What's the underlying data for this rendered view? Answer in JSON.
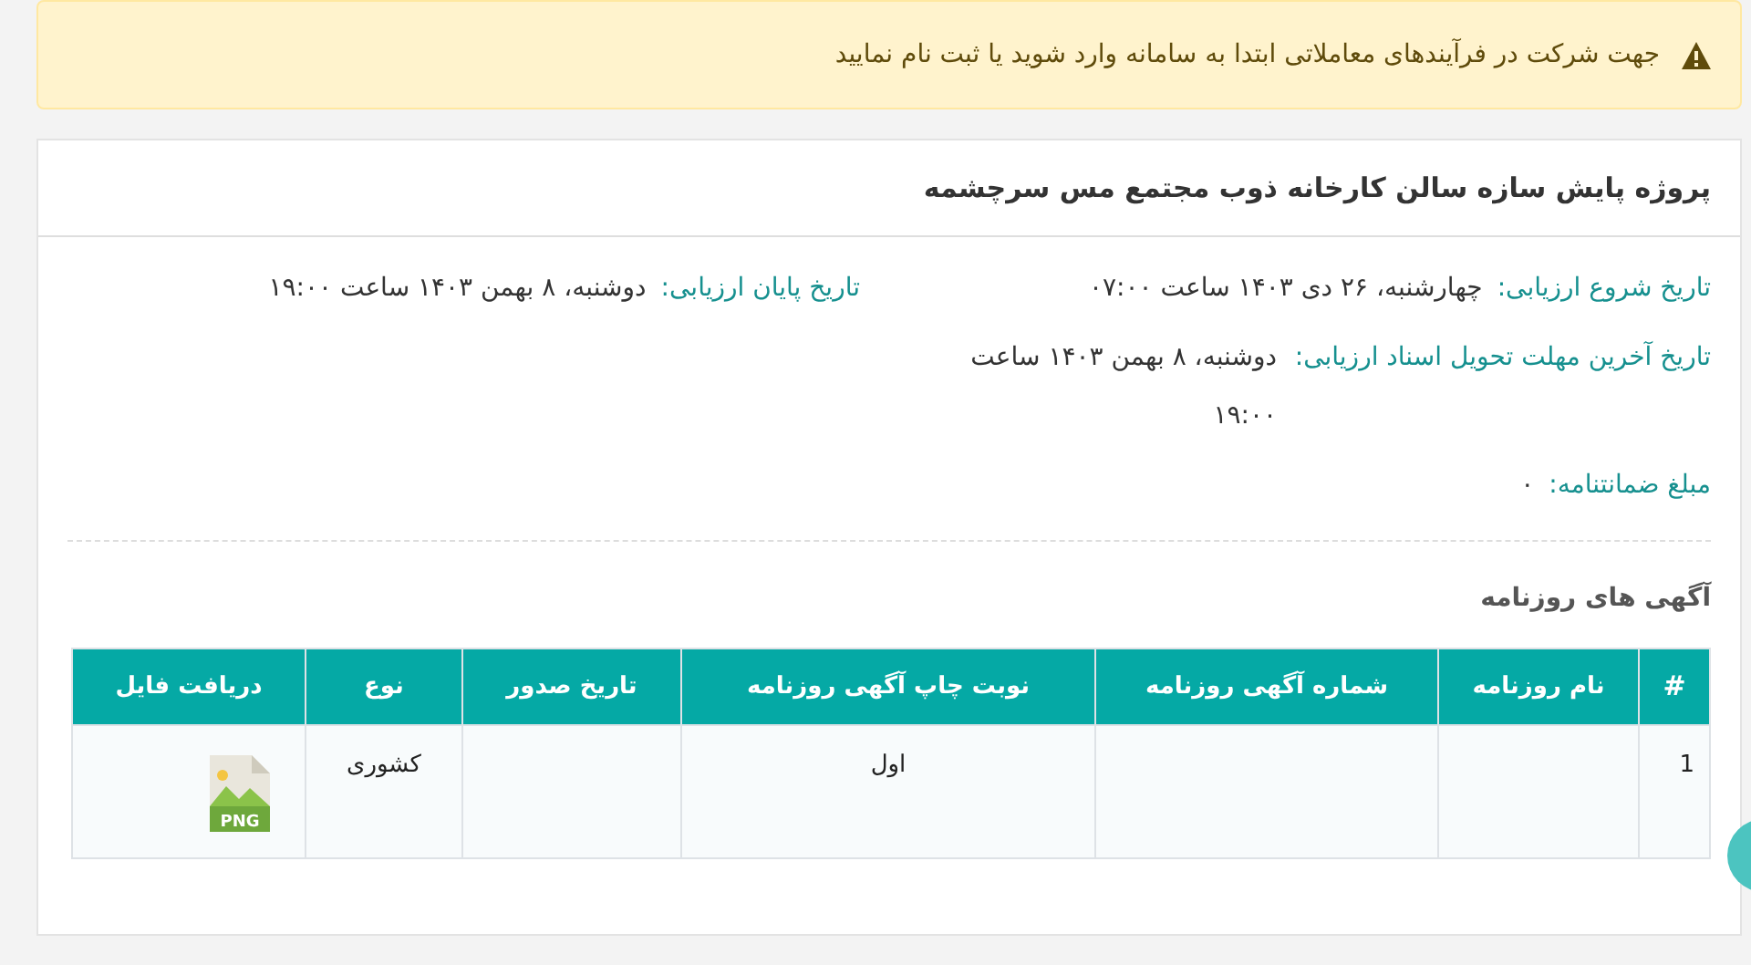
{
  "alert": {
    "text": "جهت شرکت در فرآیندهای معاملاتی ابتدا به سامانه وارد شوید یا ثبت نام نمایید"
  },
  "card": {
    "title": "پروژه پایش سازه سالن کارخانه ذوب مجتمع مس سرچشمه",
    "fields": [
      {
        "kind": "inline",
        "label": "تاریخ شروع ارزیابی:",
        "value": "چهارشنبه، ۲۶ دی ۱۴۰۳ ساعت ۰۷:۰۰"
      },
      {
        "kind": "inline",
        "label": "تاریخ پایان ارزیابی:",
        "value": "دوشنبه، ۸ بهمن ۱۴۰۳ ساعت ۱۹:۰۰"
      },
      {
        "kind": "wrapped",
        "label": "تاریخ آخرین مهلت تحویل اسناد ارزیابی:",
        "value": "دوشنبه، ۸ بهمن ۱۴۰۳ ساعت ۱۹:۰۰"
      },
      {
        "kind": "inline",
        "label": "مبلغ ضمانتنامه:",
        "value": "۰"
      }
    ],
    "section_title": "آگهی های روزنامه",
    "table": {
      "columns": [
        "#",
        "نام روزنامه",
        "شماره آگهی روزنامه",
        "نوبت چاپ آگهی روزنامه",
        "تاریخ صدور",
        "نوع",
        "دریافت فایل"
      ],
      "rows": [
        {
          "cells": [
            "1",
            "",
            "",
            "اول",
            "",
            "کشوری"
          ],
          "file_type": "PNG"
        }
      ]
    }
  }
}
